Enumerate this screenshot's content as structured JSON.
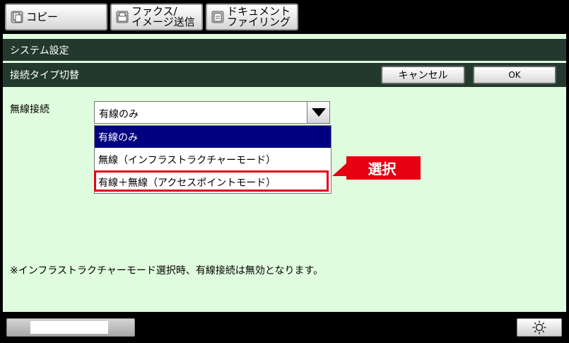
{
  "tabs": [
    {
      "label": "コピー",
      "icon": "copy-icon"
    },
    {
      "label": "ファクス/\nイメージ送信",
      "icon": "fax-icon"
    },
    {
      "label": "ドキュメント\nファイリング",
      "icon": "document-filing-icon"
    }
  ],
  "breadcrumb": {
    "system": "システム設定",
    "page": "接続タイプ切替"
  },
  "buttons": {
    "cancel": "キャンセル",
    "ok": "OK"
  },
  "form": {
    "label": "無線接続",
    "selected": "有線のみ",
    "options": [
      "有線のみ",
      "無線（インフラストラクチャーモード）",
      "有線＋無線（アクセスポイントモード）"
    ]
  },
  "callout": "選択",
  "note": "※インフラストラクチャーモード選択時、有線接続は無効となります。",
  "colors": {
    "header_bar": "#23392d",
    "panel": "#e0fcde",
    "selected_option": "#000080",
    "highlight": "#e60012"
  },
  "icons": {
    "dropdown": "dropdown-arrow-icon",
    "brightness": "brightness-icon"
  }
}
